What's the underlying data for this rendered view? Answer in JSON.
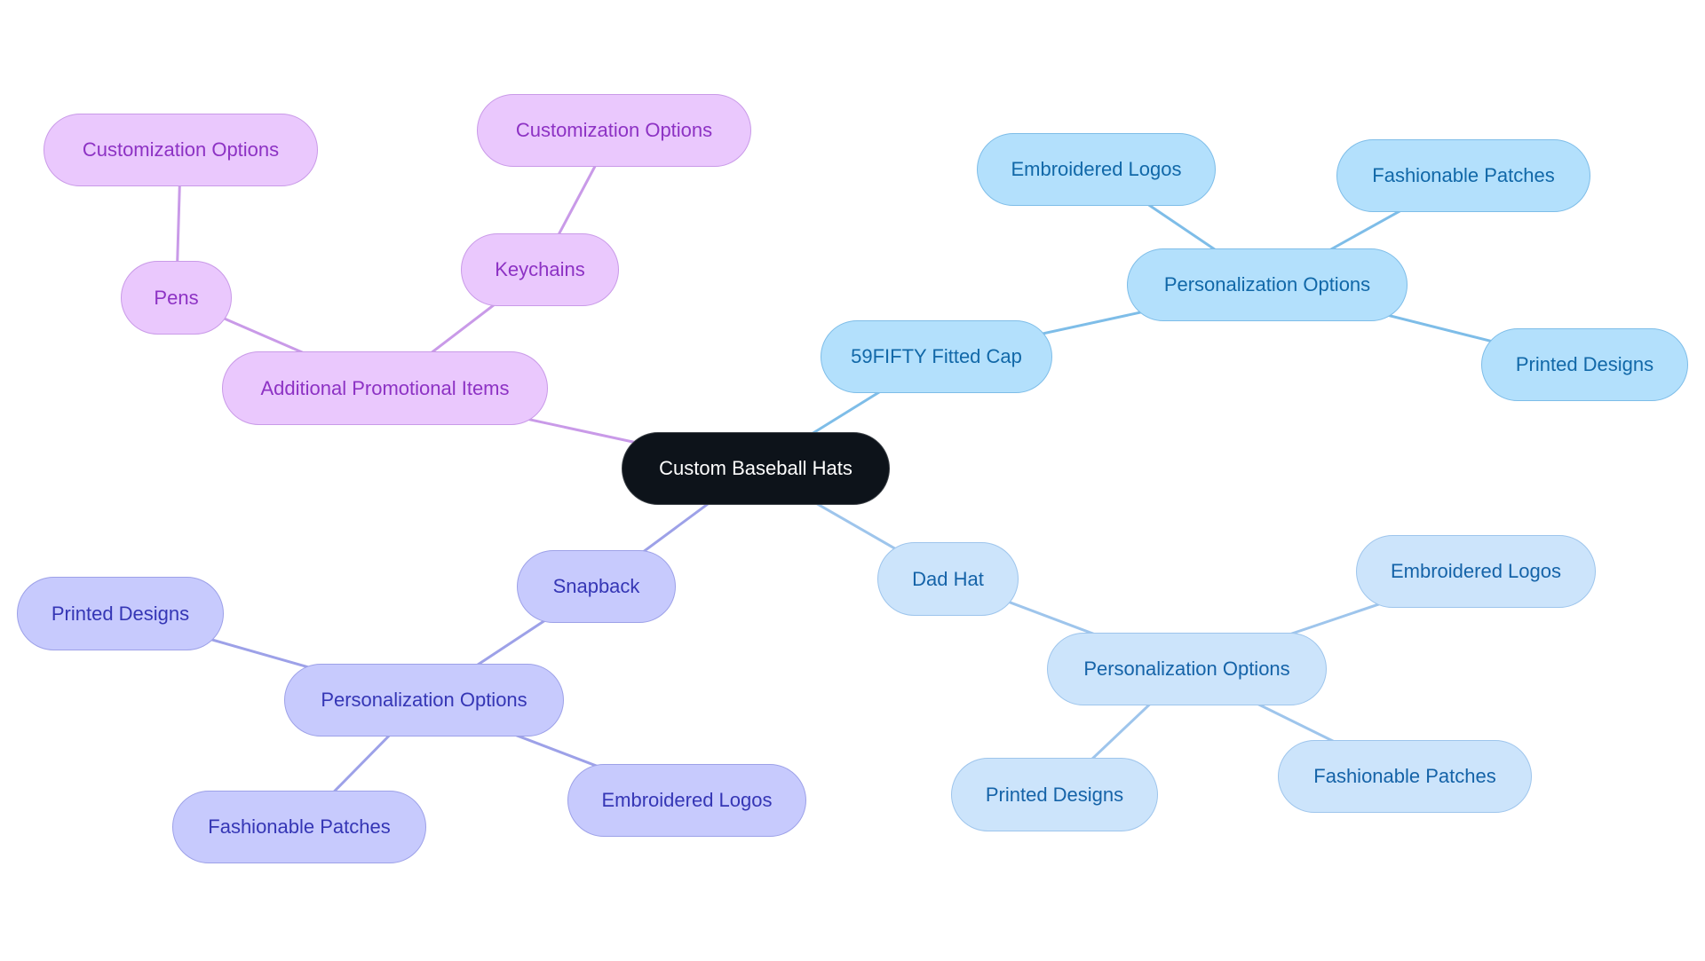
{
  "diagram": {
    "type": "mindmap",
    "colors": {
      "root": "#0d131a",
      "purple_branch": "#c99ae8",
      "sky_branch": "#7ebde8",
      "pale_branch": "#9ec5ec",
      "indigo_branch": "#9da1e8"
    },
    "root": {
      "id": "root",
      "label": "Custom Baseball Hats"
    },
    "nodes": [
      {
        "id": "api",
        "label": "Additional Promotional Items",
        "parent": "root",
        "branch": "purple"
      },
      {
        "id": "pens",
        "label": "Pens",
        "parent": "api",
        "branch": "purple"
      },
      {
        "id": "co_pens",
        "label": "Customization Options",
        "parent": "pens",
        "branch": "purple"
      },
      {
        "id": "keychains",
        "label": "Keychains",
        "parent": "api",
        "branch": "purple"
      },
      {
        "id": "co_key",
        "label": "Customization Options",
        "parent": "keychains",
        "branch": "purple"
      },
      {
        "id": "fitted",
        "label": "59FIFTY Fitted Cap",
        "parent": "root",
        "branch": "sky"
      },
      {
        "id": "po_fitted",
        "label": "Personalization Options",
        "parent": "fitted",
        "branch": "sky"
      },
      {
        "id": "el_fitted",
        "label": "Embroidered Logos",
        "parent": "po_fitted",
        "branch": "sky"
      },
      {
        "id": "fp_fitted",
        "label": "Fashionable Patches",
        "parent": "po_fitted",
        "branch": "sky"
      },
      {
        "id": "pd_fitted",
        "label": "Printed Designs",
        "parent": "po_fitted",
        "branch": "sky"
      },
      {
        "id": "dad",
        "label": "Dad Hat",
        "parent": "root",
        "branch": "pale"
      },
      {
        "id": "po_dad",
        "label": "Personalization Options",
        "parent": "dad",
        "branch": "pale"
      },
      {
        "id": "el_dad",
        "label": "Embroidered Logos",
        "parent": "po_dad",
        "branch": "pale"
      },
      {
        "id": "pd_dad",
        "label": "Printed Designs",
        "parent": "po_dad",
        "branch": "pale"
      },
      {
        "id": "fp_dad",
        "label": "Fashionable Patches",
        "parent": "po_dad",
        "branch": "pale"
      },
      {
        "id": "snap",
        "label": "Snapback",
        "parent": "root",
        "branch": "indigo"
      },
      {
        "id": "po_snap",
        "label": "Personalization Options",
        "parent": "snap",
        "branch": "indigo"
      },
      {
        "id": "pd_snap",
        "label": "Printed Designs",
        "parent": "po_snap",
        "branch": "indigo"
      },
      {
        "id": "fp_snap",
        "label": "Fashionable Patches",
        "parent": "po_snap",
        "branch": "indigo"
      },
      {
        "id": "el_snap",
        "label": "Embroidered Logos",
        "parent": "po_snap",
        "branch": "indigo"
      }
    ]
  }
}
